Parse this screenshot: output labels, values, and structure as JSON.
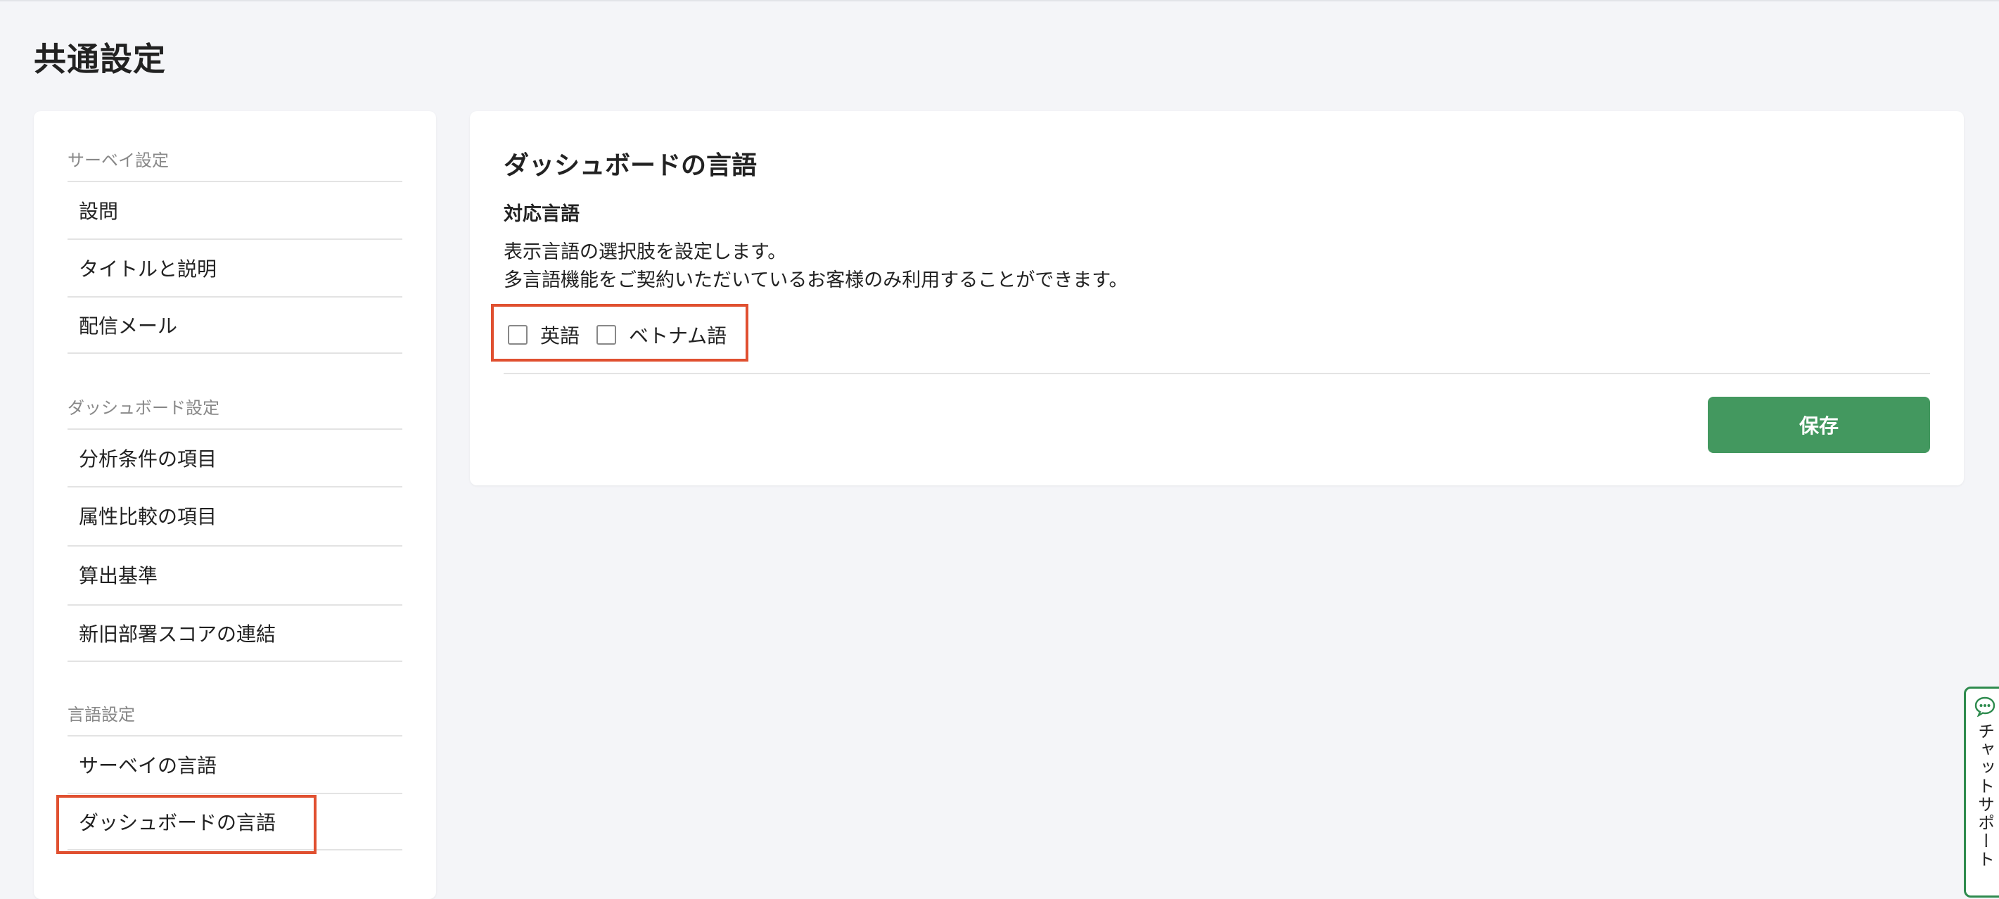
{
  "page": {
    "title": "共通設定"
  },
  "sidebar": {
    "sections": [
      {
        "heading": "サーベイ設定",
        "items": [
          "設問",
          "タイトルと説明",
          "配信メール"
        ]
      },
      {
        "heading": "ダッシュボード設定",
        "items": [
          "分析条件の項目",
          "属性比較の項目",
          "算出基準",
          "新旧部署スコアの連結"
        ]
      },
      {
        "heading": "言語設定",
        "items": [
          "サーベイの言語",
          "ダッシュボードの言語"
        ]
      }
    ],
    "active_item": "ダッシュボードの言語"
  },
  "main": {
    "title": "ダッシュボードの言語",
    "field_label": "対応言語",
    "description_line1": "表示言語の選択肢を設定します。",
    "description_line2": "多言語機能をご契約いただいているお客様のみ利用することができます。",
    "options": [
      {
        "label": "英語",
        "checked": false
      },
      {
        "label": "ベトナム語",
        "checked": false
      }
    ],
    "save_label": "保存"
  },
  "chat_support": {
    "label": "チャットサポート"
  },
  "colors": {
    "accent_green": "#43985f",
    "highlight_red": "#e05030",
    "background": "#f4f5f8"
  }
}
